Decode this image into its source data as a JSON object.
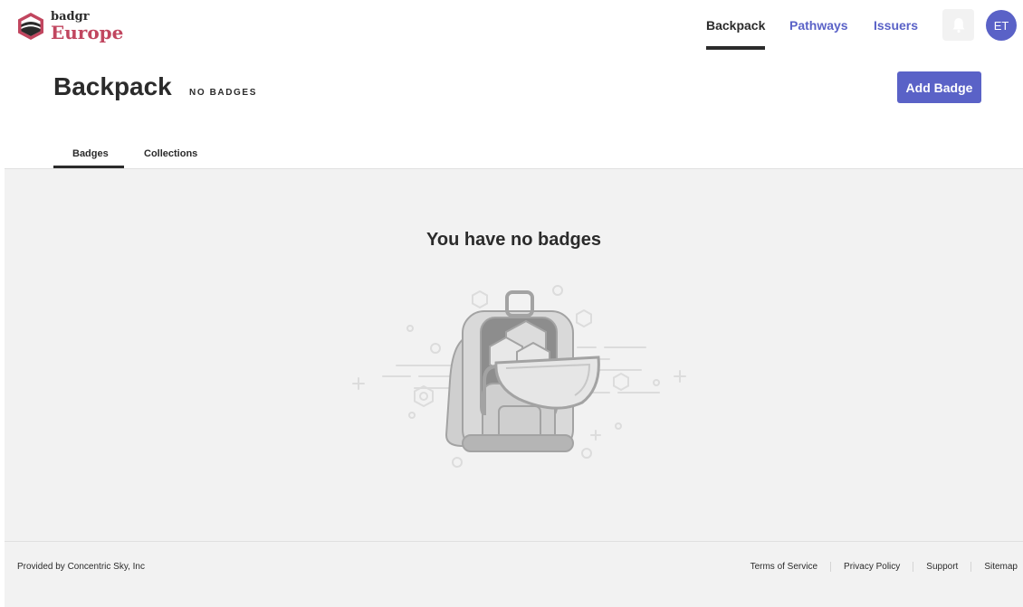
{
  "brand": {
    "name_small": "badgr",
    "name_large": "Europe",
    "accent_color": "#c1465f",
    "primary_color": "#5a62c7"
  },
  "nav": {
    "items": [
      {
        "label": "Backpack",
        "active": true
      },
      {
        "label": "Pathways",
        "active": false
      },
      {
        "label": "Issuers",
        "active": false
      }
    ],
    "notification_icon": "bell-icon",
    "avatar_initials": "ET"
  },
  "page": {
    "title": "Backpack",
    "badge_count_label": "NO BADGES",
    "add_badge_label": "Add Badge"
  },
  "tabs": [
    {
      "label": "Badges",
      "active": true
    },
    {
      "label": "Collections",
      "active": false
    }
  ],
  "empty_state": {
    "title": "You have no badges",
    "illustration_icon": "empty-backpack-icon"
  },
  "footer": {
    "provider": "Provided by Concentric Sky, Inc",
    "links": [
      "Terms of Service",
      "Privacy Policy",
      "Support",
      "Sitemap"
    ]
  }
}
